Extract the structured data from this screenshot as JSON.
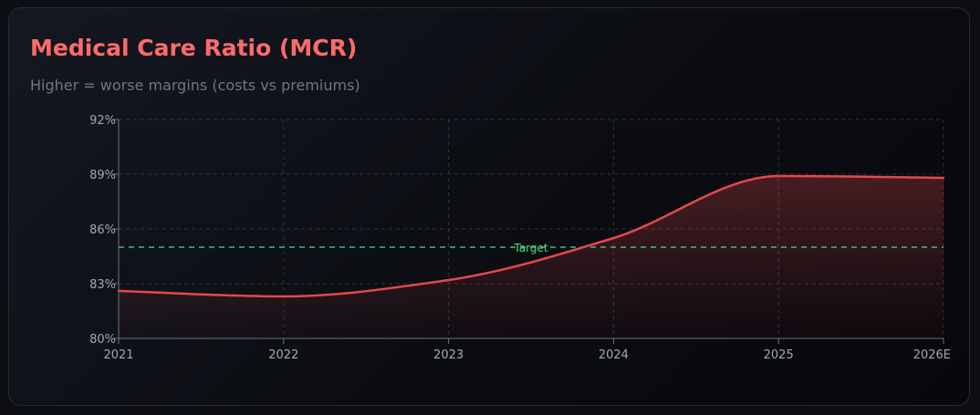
{
  "card": {
    "title": "Medical Care Ratio (MCR)",
    "subtitle": "Higher = worse margins (costs vs premiums)"
  },
  "colors": {
    "title": "#ff6b6b",
    "line": "#e5484d",
    "target": "#4ade80",
    "grid": "#2c313b",
    "axis": "#6b7180"
  },
  "chart_data": {
    "type": "area",
    "categories": [
      "2021",
      "2022",
      "2023",
      "2024",
      "2025",
      "2026E"
    ],
    "series": [
      {
        "values": [
          82.6,
          82.3,
          83.2,
          85.5,
          88.9,
          88.8
        ]
      }
    ],
    "y_ticks": [
      "80%",
      "83%",
      "86%",
      "89%",
      "92%"
    ],
    "ylim": [
      80,
      92
    ],
    "y_tick_values": [
      80,
      83,
      86,
      89,
      92
    ],
    "reference_line": {
      "label": "Target",
      "value": 85
    },
    "grid": true,
    "title": "",
    "xlabel": "",
    "ylabel": ""
  }
}
